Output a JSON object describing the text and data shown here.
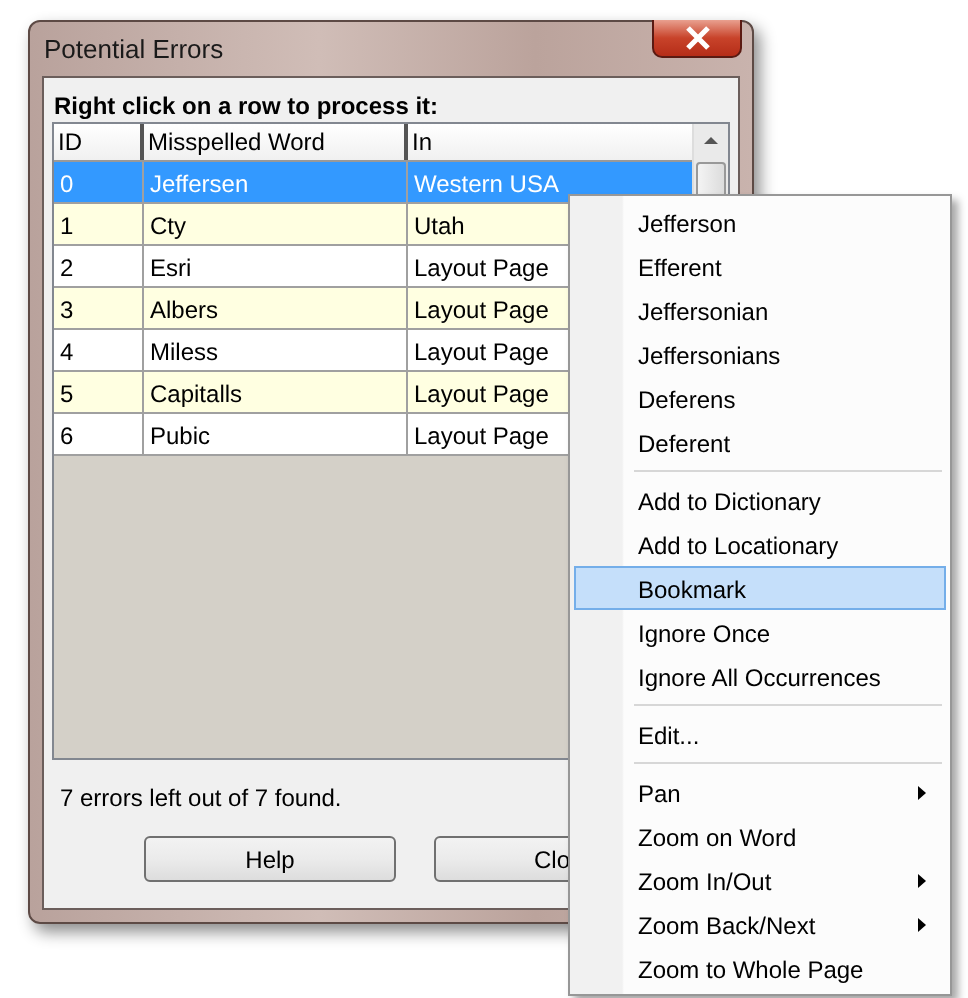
{
  "window": {
    "title": "Potential Errors"
  },
  "instruction": "Right click on a row to process it:",
  "table": {
    "columns": [
      "ID",
      "Misspelled Word",
      "In"
    ],
    "rows": [
      {
        "id": "0",
        "word": "Jeffersen",
        "in": "Western USA",
        "selected": true
      },
      {
        "id": "1",
        "word": "Cty",
        "in": "Utah",
        "selected": false
      },
      {
        "id": "2",
        "word": "Esri",
        "in": "Layout Page",
        "selected": false
      },
      {
        "id": "3",
        "word": "Albers",
        "in": "Layout Page",
        "selected": false
      },
      {
        "id": "4",
        "word": "Miless",
        "in": "Layout Page",
        "selected": false
      },
      {
        "id": "5",
        "word": "Capitalls",
        "in": "Layout Page",
        "selected": false
      },
      {
        "id": "6",
        "word": "Pubic",
        "in": "Layout Page",
        "selected": false
      }
    ]
  },
  "status": "7 errors left out of 7 found.",
  "buttons": [
    "Help",
    "Clo"
  ],
  "context_menu": {
    "groups": [
      [
        {
          "label": "Jefferson",
          "selected": false,
          "submenu": false
        },
        {
          "label": "Efferent",
          "selected": false,
          "submenu": false
        },
        {
          "label": "Jeffersonian",
          "selected": false,
          "submenu": false
        },
        {
          "label": "Jeffersonians",
          "selected": false,
          "submenu": false
        },
        {
          "label": "Deferens",
          "selected": false,
          "submenu": false
        },
        {
          "label": "Deferent",
          "selected": false,
          "submenu": false
        }
      ],
      [
        {
          "label": "Add to Dictionary",
          "selected": false,
          "submenu": false
        },
        {
          "label": "Add to Locationary",
          "selected": false,
          "submenu": false
        },
        {
          "label": "Bookmark",
          "selected": true,
          "submenu": false
        },
        {
          "label": "Ignore Once",
          "selected": false,
          "submenu": false
        },
        {
          "label": "Ignore All Occurrences",
          "selected": false,
          "submenu": false
        }
      ],
      [
        {
          "label": "Edit...",
          "selected": false,
          "submenu": false
        }
      ],
      [
        {
          "label": "Pan",
          "selected": false,
          "submenu": true
        },
        {
          "label": "Zoom on Word",
          "selected": false,
          "submenu": false
        },
        {
          "label": "Zoom In/Out",
          "selected": false,
          "submenu": true
        },
        {
          "label": "Zoom Back/Next",
          "selected": false,
          "submenu": true
        },
        {
          "label": "Zoom to Whole Page",
          "selected": false,
          "submenu": false
        }
      ]
    ]
  }
}
